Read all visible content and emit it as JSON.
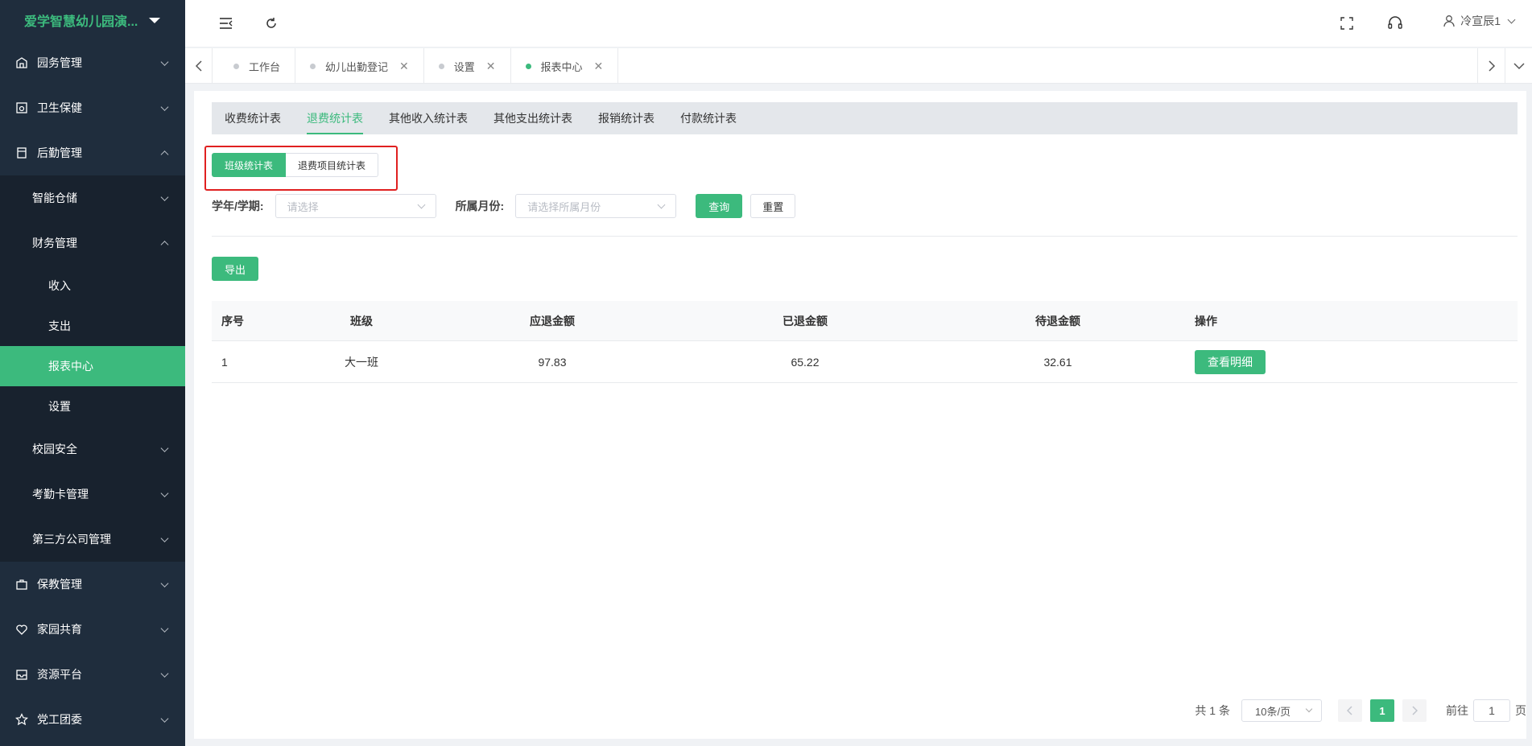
{
  "app": {
    "title": "爱学智慧幼儿园演..."
  },
  "sidebar": {
    "items": [
      {
        "label": "园务管理",
        "icon": "building-icon"
      },
      {
        "label": "卫生保健",
        "icon": "health-icon"
      },
      {
        "label": "后勤管理",
        "icon": "logistics-icon"
      }
    ],
    "logistics_sub": [
      {
        "label": "智能仓储"
      },
      {
        "label": "财务管理"
      }
    ],
    "finance_sub": [
      {
        "label": "收入"
      },
      {
        "label": "支出"
      },
      {
        "label": "报表中心"
      },
      {
        "label": "设置"
      }
    ],
    "logistics_sub_tail": [
      {
        "label": "校园安全"
      },
      {
        "label": "考勤卡管理"
      },
      {
        "label": "第三方公司管理"
      }
    ],
    "bottom_items": [
      {
        "label": "保教管理",
        "icon": "briefcase-icon"
      },
      {
        "label": "家园共育",
        "icon": "heart-icon"
      },
      {
        "label": "资源平台",
        "icon": "inbox-icon"
      },
      {
        "label": "党工团委",
        "icon": "star-icon"
      }
    ]
  },
  "header": {
    "user": "冷宣辰1"
  },
  "tabs": [
    {
      "label": "工作台",
      "closable": false
    },
    {
      "label": "幼儿出勤登记",
      "closable": true
    },
    {
      "label": "设置",
      "closable": true
    },
    {
      "label": "报表中心",
      "closable": true,
      "active": true
    }
  ],
  "report_tabs": [
    "收费统计表",
    "退费统计表",
    "其他收入统计表",
    "其他支出统计表",
    "报销统计表",
    "付款统计表"
  ],
  "segment": {
    "on": "班级统计表",
    "off": "退费项目统计表"
  },
  "filters": {
    "term_label": "学年/学期:",
    "term_placeholder": "请选择",
    "month_label": "所属月份:",
    "month_placeholder": "请选择所属月份",
    "query": "查询",
    "reset": "重置"
  },
  "export_label": "导出",
  "table": {
    "headers": [
      "序号",
      "班级",
      "应退金额",
      "已退金额",
      "待退金额",
      "操作"
    ],
    "rows": [
      {
        "no": "1",
        "class": "大一班",
        "due": "97.83",
        "refunded": "65.22",
        "pending": "32.61",
        "action": "查看明细"
      }
    ]
  },
  "pagination": {
    "total": "共 1 条",
    "page_size": "10条/页",
    "current": "1",
    "goto_label": "前往",
    "goto_value": "1",
    "page_suffix": "页"
  },
  "colors": {
    "accent": "#3cba7d",
    "sidebar_bg": "#1f2d3d",
    "highlight": "#e02020"
  }
}
